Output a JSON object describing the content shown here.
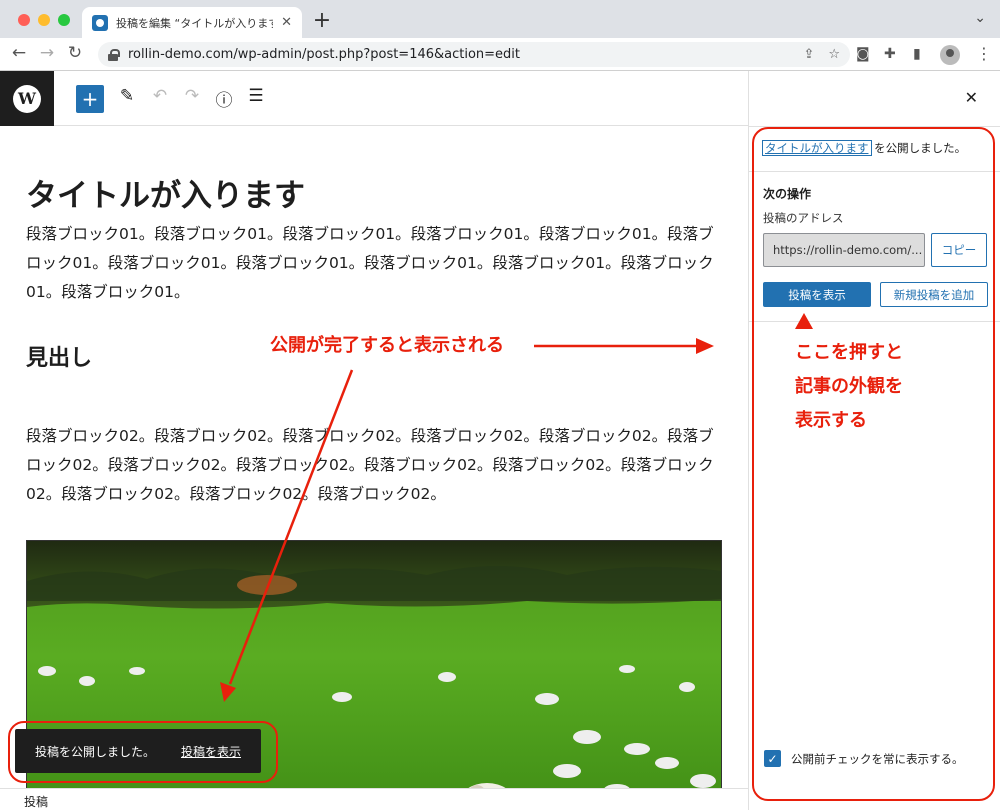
{
  "browser": {
    "tab_title": "投稿を編集 “タイトルが入ります” ‹ rollin-demo",
    "url": "rollin-demo.com/wp-admin/post.php?post=146&action=edit"
  },
  "editor": {
    "post_title": "タイトルが入ります",
    "paragraph1": "段落ブロック01。段落ブロック01。段落ブロック01。段落ブロック01。段落ブロック01。段落ブロック01。段落ブロック01。段落ブロック01。段落ブロック01。段落ブロック01。段落ブロック01。段落ブロック01。",
    "heading": "見出し",
    "paragraph2": "段落ブロック02。段落ブロック02。段落ブロック02。段落ブロック02。段落ブロック02。段落ブロック02。段落ブロック02。段落ブロック02。段落ブロック02。段落ブロック02。段落ブロック02。段落ブロック02。段落ブロック02。段落ブロック02。",
    "status_footer": "投稿"
  },
  "snackbar": {
    "message": "投稿を公開しました。",
    "link": "投稿を表示"
  },
  "panel": {
    "published_link": "タイトルが入ります",
    "published_suffix": " を公開しました。",
    "next_actions_label": "次の操作",
    "post_address_label": "投稿のアドレス",
    "post_url": "https://rollin-demo.com/...",
    "copy_button": "コピー",
    "view_post_button": "投稿を表示",
    "add_new_button": "新規投稿を追加",
    "checkbox_label": "公開前チェックを常に表示する。",
    "checkbox_checked": true
  },
  "annotations": {
    "main": "公開が完了すると表示される",
    "side_line1": "ここを押すと",
    "side_line2": "記事の外観を",
    "side_line3": "表示する",
    "color": "#e8200c"
  },
  "colors": {
    "accent": "#2271b1",
    "dark": "#1e1e1e"
  }
}
